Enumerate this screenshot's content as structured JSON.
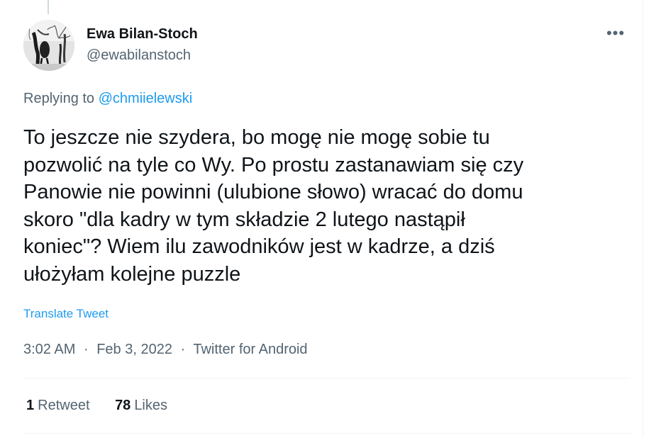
{
  "author": {
    "display_name": "Ewa Bilan-Stoch",
    "handle": "@ewabilanstoch"
  },
  "more_icon": "more-horizontal-icon",
  "reply": {
    "prefix": "Replying to",
    "mention": "@chmiielewski"
  },
  "tweet": {
    "lines": [
      "To jeszcze nie szydera, bo mogę nie mogę sobie tu",
      "pozwolić na tyle co Wy. Po prostu zastanawiam się czy",
      "Panowie nie powinni (ulubione słowo) wracać do domu",
      "skoro \"dla kadry w tym składzie 2 lutego nastąpił",
      "koniec\"? Wiem ilu zawodników jest w kadrze, a dziś",
      "ułożyłam kolejne puzzle"
    ],
    "translate_label": "Translate Tweet"
  },
  "meta": {
    "time": "3:02 AM",
    "separator": "·",
    "date": "Feb 3, 2022",
    "source": "Twitter for Android"
  },
  "stats": {
    "retweets_count": "1",
    "retweets_label": "Retweet",
    "likes_count": "78",
    "likes_label": "Likes"
  },
  "colors": {
    "text": "#0f1419",
    "secondary": "#536471",
    "accent": "#1d9bf0",
    "border": "#eff3f4"
  }
}
